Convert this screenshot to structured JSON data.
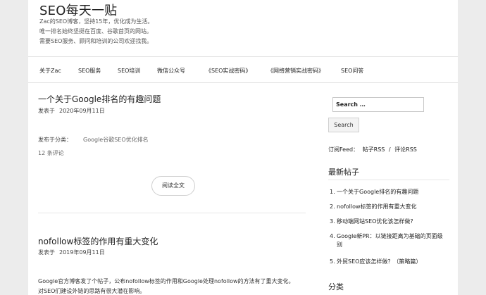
{
  "site": {
    "title": "SEO每天一贴",
    "description_lines": [
      "Zac的SEO博客，坚持15年，优化成为生活。",
      "唯一排名始终坚挺在百度、谷歌首页的网站。",
      "需要SEO服务、顾问和培训的公司欢迎找我。"
    ]
  },
  "nav": {
    "items": [
      "关于Zac",
      "SEO服务",
      "SEO培训",
      "微信公众号",
      "《SEO实战密码》",
      "《网络营销实战密码》",
      "SEO问答"
    ]
  },
  "posts": [
    {
      "title": "一个关于Google排名的有趣问题",
      "date_label": "发表于",
      "date": "2020年09月11日",
      "category_label": "发布于分类：",
      "category": "Google谷歌SEO优化排名",
      "comments": "12 条评论",
      "read_more": "阅读全文"
    },
    {
      "title": "nofollow标签的作用有重大变化",
      "date_label": "发表于",
      "date": "2019年09月11日",
      "excerpt_lines": [
        "Google官方博客发了个帖子，公布nofollow标签的作用和Google处理nofollow的方法有了重大变化。",
        "对SEO们建设外链的思路有很大潜在影响。"
      ]
    }
  ],
  "sidebar": {
    "search": {
      "placeholder": "Search …",
      "button": "Search"
    },
    "feed": {
      "label": "订阅Feed：",
      "posts_rss": "帖子RSS",
      "separator": "/",
      "comments_rss": "评论RSS"
    },
    "recent": {
      "title": "最新帖子",
      "items": [
        {
          "num": "1.",
          "text": "一个关于Google排名的有趣问题"
        },
        {
          "num": "2.",
          "text": "nofollow标签的作用有重大变化"
        },
        {
          "num": "3.",
          "text": "移动端网站SEO优化该怎样做?"
        },
        {
          "num": "4.",
          "text": "Google新PR：以链接距离为基础的页面级",
          "wrap": "别"
        },
        {
          "num": "5.",
          "text": "外贸SEO应该怎样做？（策略篇）"
        }
      ]
    },
    "categories": {
      "title": "分类"
    }
  }
}
